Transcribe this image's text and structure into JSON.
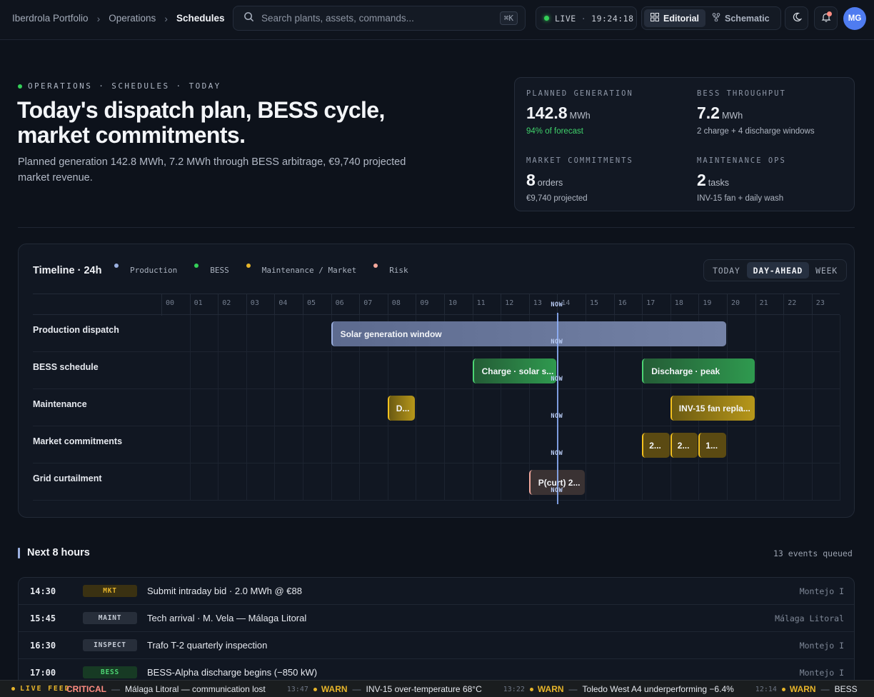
{
  "topbar": {
    "breadcrumbs": [
      "Iberdrola Portfolio",
      "Operations",
      "Schedules"
    ],
    "search_placeholder": "Search plants, assets, commands...",
    "search_shortcut": "⌘K",
    "live_label": "LIVE",
    "live_time": "19:24:18",
    "views": [
      {
        "label": "Editorial",
        "active": true
      },
      {
        "label": "Schematic",
        "active": false
      }
    ],
    "avatar_initials": "MG"
  },
  "hero": {
    "eyebrow": "OPERATIONS · SCHEDULES · TODAY",
    "title": "Today's dispatch plan, BESS cycle, market commitments.",
    "lead": "Planned generation 142.8 MWh, 7.2 MWh through BESS arbitrage, €9,740 projected market revenue."
  },
  "kpis": [
    {
      "label": "PLANNED GENERATION",
      "value": "142.8",
      "unit": "MWh",
      "sub": "94% of forecast",
      "sub_good": true
    },
    {
      "label": "BESS THROUGHPUT",
      "value": "7.2",
      "unit": "MWh",
      "sub": "2 charge + 4 discharge windows"
    },
    {
      "label": "MARKET COMMITMENTS",
      "value": "8",
      "unit": "orders",
      "sub": "€9,740 projected"
    },
    {
      "label": "MAINTENANCE OPS",
      "value": "2",
      "unit": "tasks",
      "sub": "INV-15 fan + daily wash"
    }
  ],
  "timeline": {
    "title": "Timeline · 24h",
    "legend": [
      {
        "label": "Production",
        "color": "#9bb0e0"
      },
      {
        "label": "BESS",
        "color": "#34d058"
      },
      {
        "label": "Maintenance / Market",
        "color": "#e7b52a"
      },
      {
        "label": "Risk",
        "color": "#f5a89c"
      }
    ],
    "ranges": [
      {
        "label": "TODAY",
        "active": false
      },
      {
        "label": "DAY-AHEAD",
        "active": true
      },
      {
        "label": "WEEK",
        "active": false
      }
    ],
    "hours": [
      "00",
      "01",
      "02",
      "03",
      "04",
      "05",
      "06",
      "07",
      "08",
      "09",
      "10",
      "11",
      "12",
      "13",
      "14",
      "15",
      "16",
      "17",
      "18",
      "19",
      "20",
      "21",
      "22",
      "23"
    ],
    "now_label": "NOW",
    "now_hour": 14.0,
    "lanes": [
      {
        "label": "Production dispatch",
        "bars": [
          {
            "start": 6,
            "end": 20,
            "label": "Solar generation window",
            "kind": "prod"
          }
        ]
      },
      {
        "label": "BESS schedule",
        "bars": [
          {
            "start": 11,
            "end": 14,
            "label": "Charge · solar s...",
            "kind": "bess"
          },
          {
            "start": 17,
            "end": 21,
            "label": "Discharge · peak",
            "kind": "bess"
          }
        ]
      },
      {
        "label": "Maintenance",
        "bars": [
          {
            "start": 8,
            "end": 9,
            "label": "D...",
            "kind": "maint"
          },
          {
            "start": 18,
            "end": 21,
            "label": "INV-15 fan repla...",
            "kind": "maint"
          }
        ]
      },
      {
        "label": "Market commitments",
        "bars": [
          {
            "start": 17,
            "end": 18,
            "label": "2...",
            "kind": "mkt"
          },
          {
            "start": 18,
            "end": 19,
            "label": "2...",
            "kind": "mkt"
          },
          {
            "start": 19,
            "end": 20,
            "label": "1...",
            "kind": "mkt"
          }
        ]
      },
      {
        "label": "Grid curtailment",
        "bars": [
          {
            "start": 13,
            "end": 15,
            "label": "P(curt) 2...",
            "kind": "risk"
          }
        ]
      }
    ]
  },
  "next": {
    "title": "Next 8 hours",
    "count": "13 events queued",
    "events": [
      {
        "time": "14:30",
        "tag": "MKT",
        "kind": "mkt",
        "desc": "Submit intraday bid · 2.0 MWh @ €88",
        "site": "Montejo I"
      },
      {
        "time": "15:45",
        "tag": "MAINT",
        "kind": "maint",
        "desc": "Tech arrival · M. Vela — Málaga Litoral",
        "site": "Málaga Litoral"
      },
      {
        "time": "16:30",
        "tag": "INSPECT",
        "kind": "inspect",
        "desc": "Trafo T-2 quarterly inspection",
        "site": "Montejo I"
      },
      {
        "time": "17:00",
        "tag": "BESS",
        "kind": "bess",
        "desc": "BESS-Alpha discharge begins (−850 kW)",
        "site": "Montejo I"
      }
    ]
  },
  "feed": {
    "label": "LIVE FEED",
    "items": [
      {
        "time": "",
        "sev": "CRITICAL",
        "sev_display": "CRITICAL",
        "kind": "crit",
        "text": "Málaga Litoral — communication lost"
      },
      {
        "time": "13:47",
        "sev": "WARN",
        "kind": "warn",
        "text": "INV-15 over-temperature 68°C"
      },
      {
        "time": "13:22",
        "sev": "WARN",
        "kind": "warn",
        "text": "Toledo West A4 underperforming −6.4%"
      },
      {
        "time": "12:14",
        "sev": "WARN",
        "kind": "warn",
        "text": "BESS"
      }
    ]
  }
}
